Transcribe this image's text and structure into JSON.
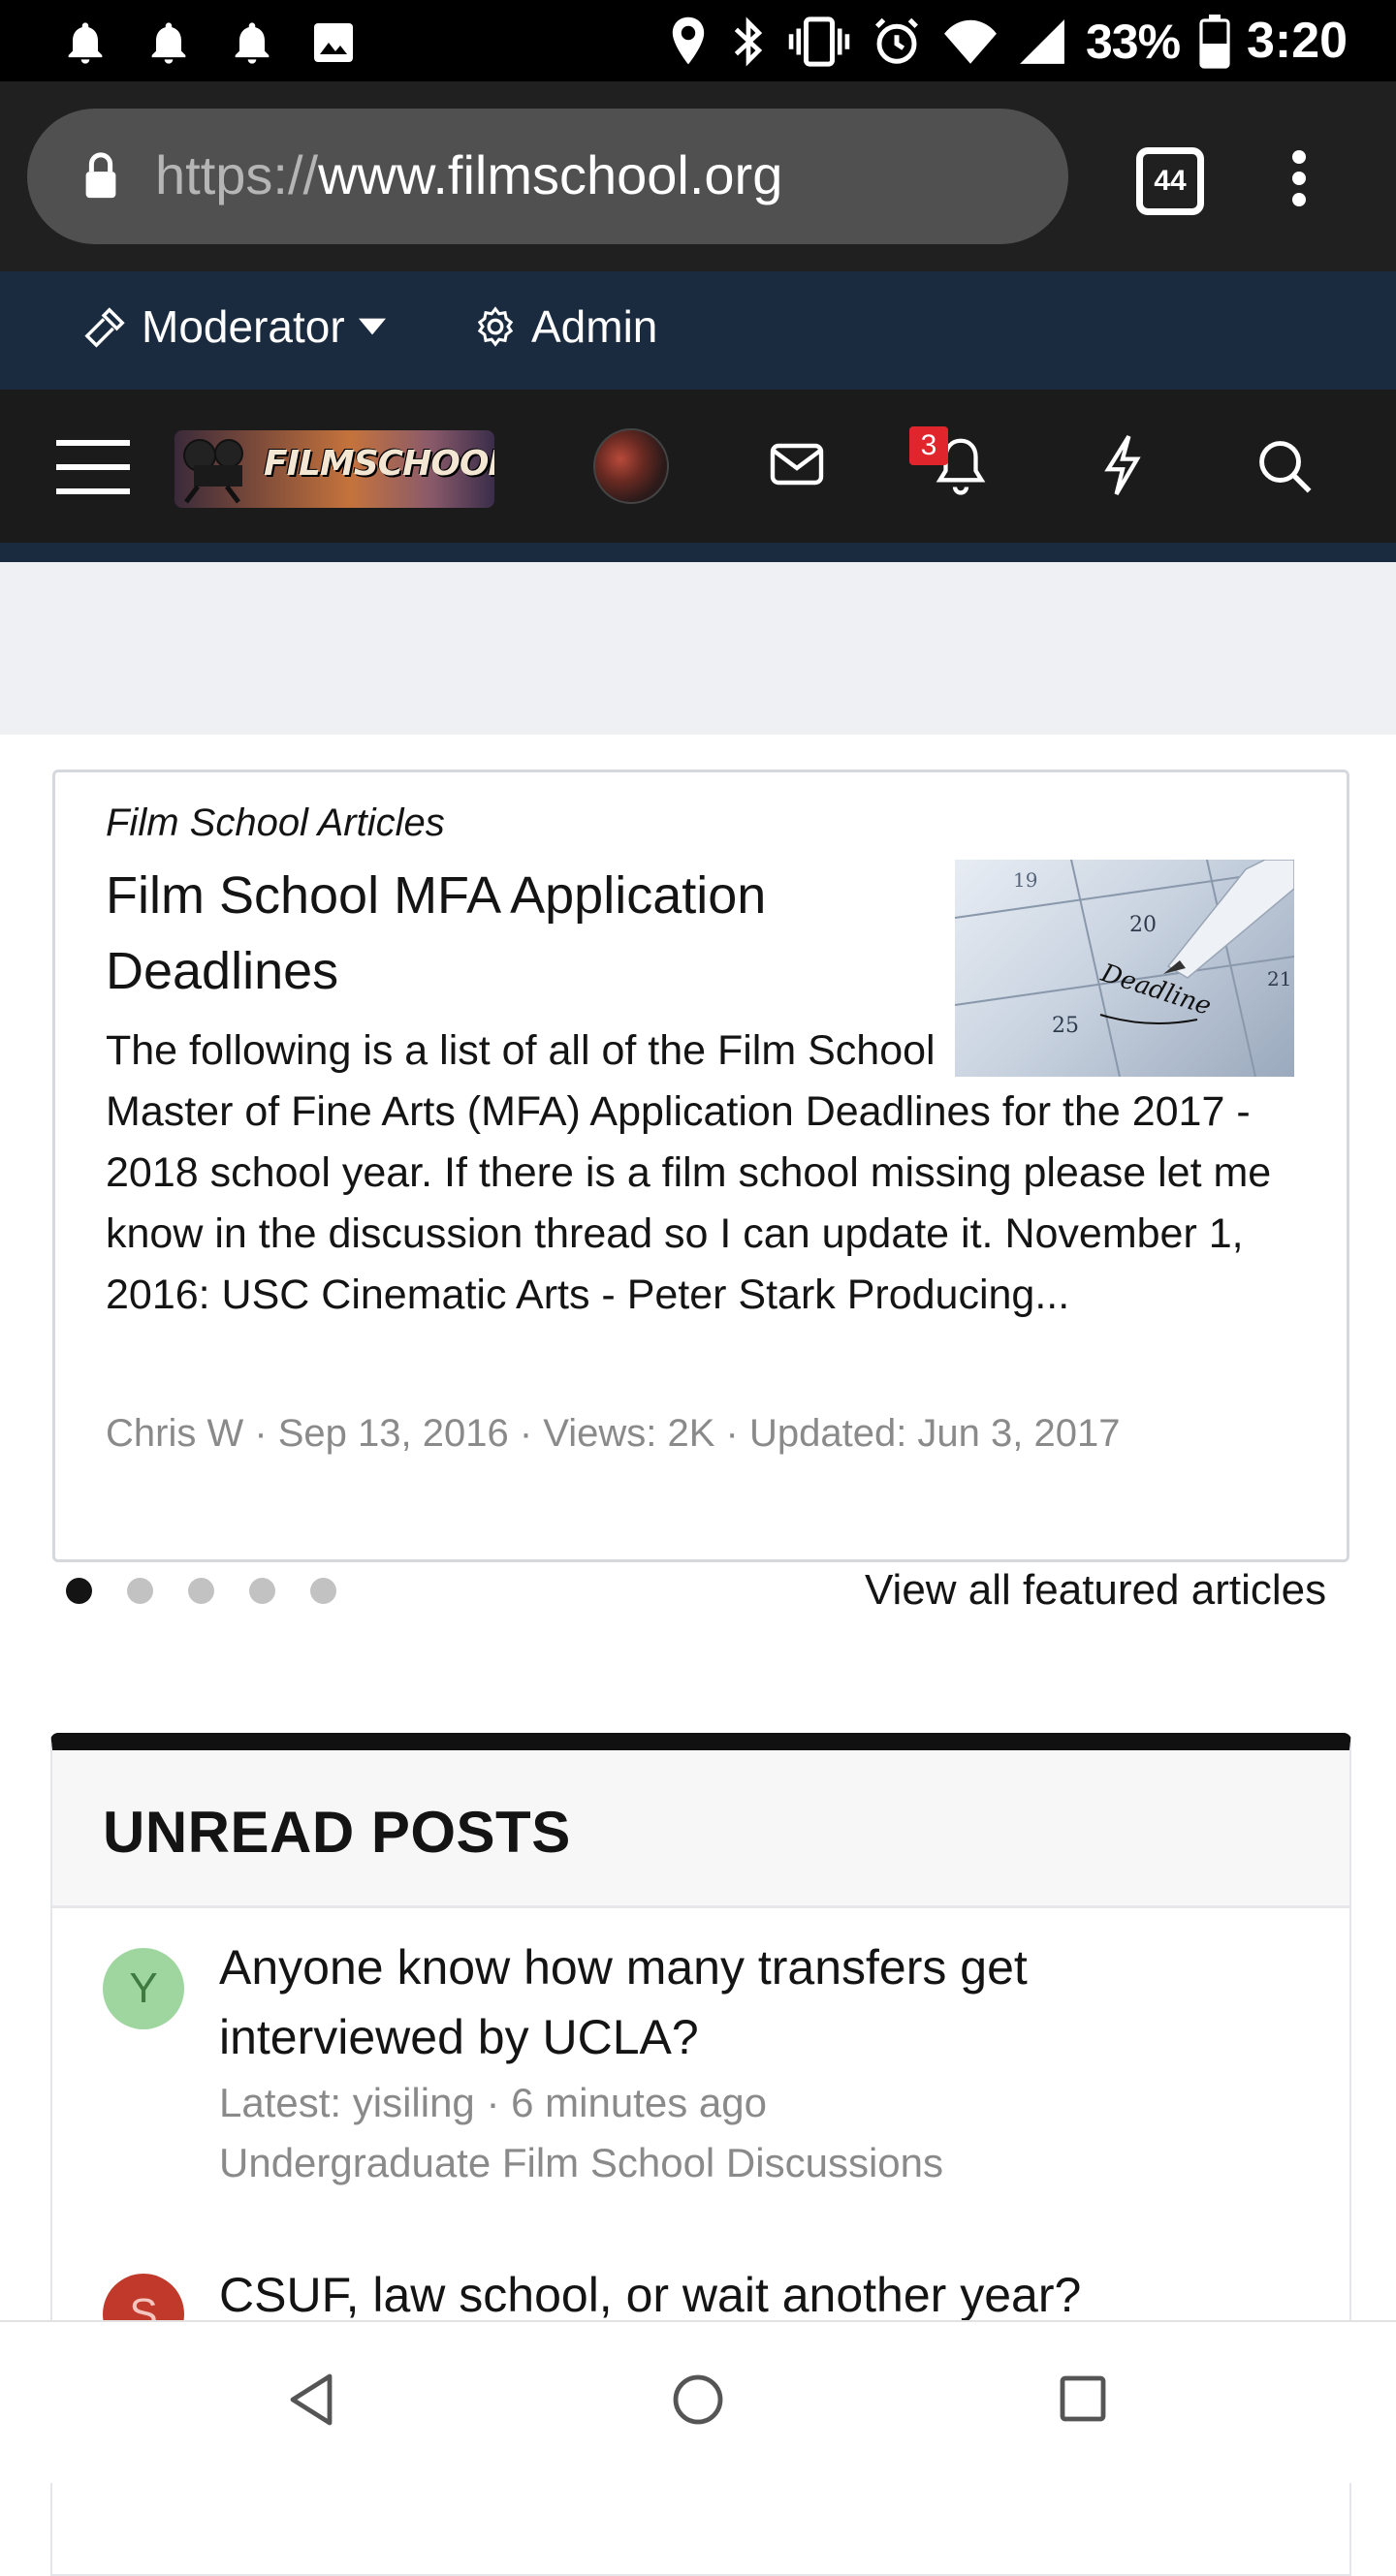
{
  "status_bar": {
    "battery": "33%",
    "time": "3:20"
  },
  "browser": {
    "url_scheme": "https://",
    "url_host": "www.filmschool.org",
    "tab_count": "44"
  },
  "admin_bar": {
    "moderator_label": "Moderator",
    "admin_label": "Admin"
  },
  "header": {
    "logo_text": "FILMSCHOOL.ORG",
    "alerts_badge": "3"
  },
  "featured": {
    "category": "Film School Articles",
    "title": "Film School MFA Application Deadlines",
    "snippet": "The following is a list of all of the Film School Master of Fine Arts (MFA) Application Deadlines for the 2017 - 2018 school year. If there is a film school missing please let me know in the discussion thread so I can update it. November 1, 2016: USC Cinematic Arts - Peter Stark Producing...",
    "meta": "Chris W · Sep 13, 2016 · Views: 2K · Updated: Jun 3, 2017",
    "thumb_numbers": [
      "19",
      "20",
      "21",
      "25"
    ],
    "thumb_word": "Deadline",
    "dots_count": 5,
    "active_dot": 0,
    "view_all_label": "View all featured articles"
  },
  "unread": {
    "title": "UNREAD POSTS",
    "posts": [
      {
        "avatar_letter": "Y",
        "avatar_bg": "#9fd6a0",
        "avatar_fg": "#3f7a41",
        "title": "Anyone know how many transfers get interviewed by UCLA?",
        "latest": "Latest: yisiling · 6 minutes ago",
        "forum": "Undergraduate Film School Discussions"
      },
      {
        "avatar_letter": "S",
        "avatar_bg": "#c0392b",
        "avatar_fg": "#f5c6c0",
        "title": "CSUF, law school, or wait another year?"
      }
    ]
  },
  "colors": {
    "admin_bar_bg": "#1a2b3f",
    "header_bg": "#1b1b1b",
    "badge_red": "#e0252c"
  }
}
